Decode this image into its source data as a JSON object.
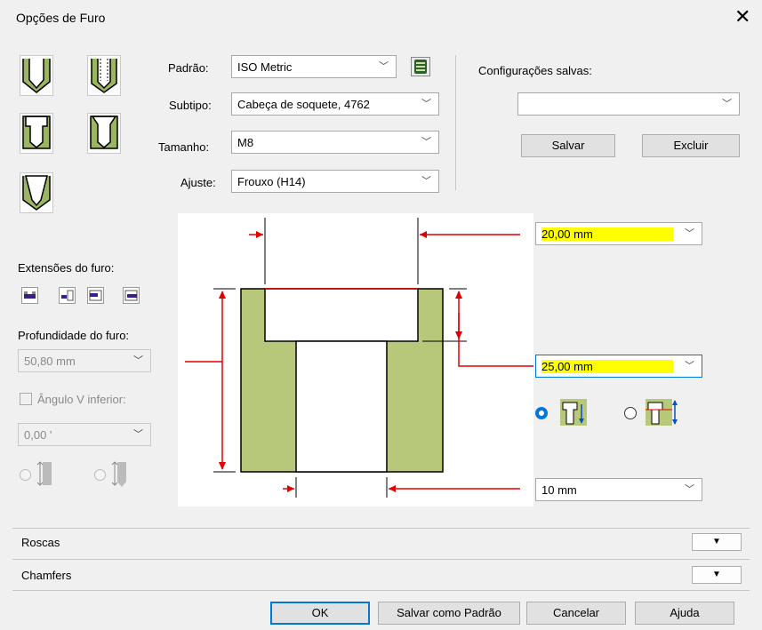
{
  "dialog": {
    "title": "Opções de Furo",
    "close_glyph": "✕"
  },
  "hole_types": [
    {
      "name": "simple-drill-hole"
    },
    {
      "name": "threaded-hole"
    },
    {
      "name": "counterbore-hole"
    },
    {
      "name": "countersink-sunk-hole"
    },
    {
      "name": "countersink-hole"
    }
  ],
  "form": {
    "standard_label": "Padrão:",
    "standard_value": "ISO Metric",
    "subtype_label": "Subtipo:",
    "subtype_value": "Cabeça de soquete, 4762",
    "size_label": "Tamanho:",
    "size_value": "M8",
    "fit_label": "Ajuste:",
    "fit_value": "Frouxo (H14)"
  },
  "saved": {
    "label": "Configurações salvas:",
    "value": "",
    "save_button": "Salvar",
    "delete_button": "Excluir"
  },
  "extents": {
    "label": "Extensões do furo:",
    "depth_label": "Profundidade do furo:",
    "depth_value": "50,80 mm",
    "angle_checkbox_label": "Ângulo V inferior:",
    "angle_value": "0,00 '"
  },
  "dimensions": {
    "counterbore_diameter": "20,00 mm",
    "counterbore_depth": "25,00 mm",
    "hole_diameter": "10 mm"
  },
  "sections": {
    "threads": "Roscas",
    "chamfers": "Chamfers",
    "expand_glyph": "▼"
  },
  "footer": {
    "ok": "OK",
    "save_default": "Salvar como Padrão",
    "cancel": "Cancelar",
    "help": "Ajuda"
  },
  "colors": {
    "material": "#b8c87a",
    "dimension": "#e00000",
    "highlight": "#ffff00",
    "accent": "#0078d7"
  }
}
